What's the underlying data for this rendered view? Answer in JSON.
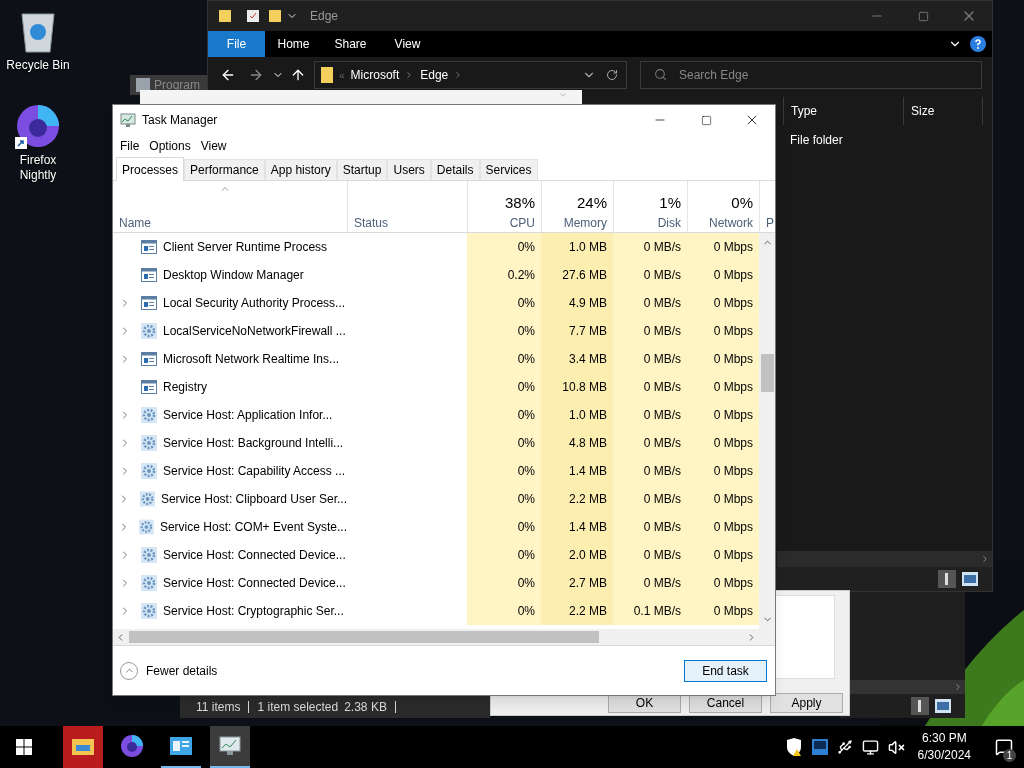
{
  "desktop": {
    "icons": [
      {
        "label": "Recycle Bin",
        "kind": "recycle",
        "shortcut": false
      },
      {
        "label": "Firefox Nightly",
        "kind": "browser",
        "shortcut": true
      }
    ]
  },
  "program_window": {
    "title": "Program"
  },
  "explorer": {
    "title": "Edge",
    "ribbon_tabs": [
      {
        "label": "File",
        "selected": true
      },
      {
        "label": "Home",
        "selected": false
      },
      {
        "label": "Share",
        "selected": false
      },
      {
        "label": "View",
        "selected": false
      }
    ],
    "overflow": "«",
    "path": [
      "Microsoft",
      "Edge"
    ],
    "search": {
      "placeholder": "Search Edge"
    },
    "columns": [
      "Type",
      "Size"
    ],
    "rows": [
      {
        "type": "File folder"
      }
    ]
  },
  "status_window": {
    "count": "11 items",
    "selection": "1 item selected",
    "size": "2.38 KB"
  },
  "dialog": {
    "buttons": [
      "OK",
      "Cancel",
      "Apply"
    ]
  },
  "task_manager": {
    "title": "Task Manager",
    "menu": [
      "File",
      "Options",
      "View"
    ],
    "tabs": [
      {
        "label": "Processes",
        "selected": true
      },
      {
        "label": "Performance",
        "selected": false
      },
      {
        "label": "App history",
        "selected": false
      },
      {
        "label": "Startup",
        "selected": false
      },
      {
        "label": "Users",
        "selected": false
      },
      {
        "label": "Details",
        "selected": false
      },
      {
        "label": "Services",
        "selected": false
      }
    ],
    "columns": [
      {
        "label": "Name",
        "sorted": true
      },
      {
        "label": "Status",
        "sorted": false
      },
      {
        "label": "CPU",
        "percent": "38%",
        "sorted": false
      },
      {
        "label": "Memory",
        "percent": "24%",
        "sorted": false
      },
      {
        "label": "Disk",
        "percent": "1%",
        "sorted": false
      },
      {
        "label": "Network",
        "percent": "0%",
        "sorted": false
      },
      {
        "label": "P",
        "sorted": false
      }
    ],
    "rows": [
      {
        "name": "Client Server Runtime Process",
        "expandable": false,
        "kind": "app",
        "cpu": "0%",
        "memory": "1.0 MB",
        "disk": "0 MB/s",
        "network": "0 Mbps"
      },
      {
        "name": "Desktop Window Manager",
        "expandable": false,
        "kind": "app",
        "cpu": "0.2%",
        "memory": "27.6 MB",
        "disk": "0 MB/s",
        "network": "0 Mbps"
      },
      {
        "name": "Local Security Authority Process...",
        "expandable": true,
        "kind": "app",
        "cpu": "0%",
        "memory": "4.9 MB",
        "disk": "0 MB/s",
        "network": "0 Mbps"
      },
      {
        "name": "LocalServiceNoNetworkFirewall ...",
        "expandable": true,
        "kind": "service",
        "cpu": "0%",
        "memory": "7.7 MB",
        "disk": "0 MB/s",
        "network": "0 Mbps"
      },
      {
        "name": "Microsoft Network Realtime Ins...",
        "expandable": true,
        "kind": "app",
        "cpu": "0%",
        "memory": "3.4 MB",
        "disk": "0 MB/s",
        "network": "0 Mbps"
      },
      {
        "name": "Registry",
        "expandable": false,
        "kind": "app",
        "cpu": "0%",
        "memory": "10.8 MB",
        "disk": "0 MB/s",
        "network": "0 Mbps"
      },
      {
        "name": "Service Host: Application Infor...",
        "expandable": true,
        "kind": "service",
        "cpu": "0%",
        "memory": "1.0 MB",
        "disk": "0 MB/s",
        "network": "0 Mbps"
      },
      {
        "name": "Service Host: Background Intelli...",
        "expandable": true,
        "kind": "service",
        "cpu": "0%",
        "memory": "4.8 MB",
        "disk": "0 MB/s",
        "network": "0 Mbps"
      },
      {
        "name": "Service Host: Capability Access ...",
        "expandable": true,
        "kind": "service",
        "cpu": "0%",
        "memory": "1.4 MB",
        "disk": "0 MB/s",
        "network": "0 Mbps"
      },
      {
        "name": "Service Host: Clipboard User Ser...",
        "expandable": true,
        "kind": "service",
        "cpu": "0%",
        "memory": "2.2 MB",
        "disk": "0 MB/s",
        "network": "0 Mbps"
      },
      {
        "name": "Service Host: COM+ Event Syste...",
        "expandable": true,
        "kind": "service",
        "cpu": "0%",
        "memory": "1.4 MB",
        "disk": "0 MB/s",
        "network": "0 Mbps"
      },
      {
        "name": "Service Host: Connected Device...",
        "expandable": true,
        "kind": "service",
        "cpu": "0%",
        "memory": "2.0 MB",
        "disk": "0 MB/s",
        "network": "0 Mbps"
      },
      {
        "name": "Service Host: Connected Device...",
        "expandable": true,
        "kind": "service",
        "cpu": "0%",
        "memory": "2.7 MB",
        "disk": "0 MB/s",
        "network": "0 Mbps"
      },
      {
        "name": "Service Host: Cryptographic Ser...",
        "expandable": true,
        "kind": "service",
        "cpu": "0%",
        "memory": "2.2 MB",
        "disk": "0.1 MB/s",
        "network": "0 Mbps"
      }
    ],
    "footer": {
      "toggle": "Fewer details",
      "button": "End task"
    }
  },
  "taskbar": {
    "apps": [
      {
        "kind": "explorer",
        "running": false,
        "selected": false,
        "attention": true
      },
      {
        "kind": "browser",
        "running": false,
        "selected": false,
        "attention": false
      },
      {
        "kind": "control-panel",
        "running": true,
        "selected": false,
        "attention": false
      },
      {
        "kind": "task-manager",
        "running": true,
        "selected": true,
        "attention": false
      }
    ],
    "time": "6:30 PM",
    "date": "6/30/2024",
    "notifications": "1"
  }
}
